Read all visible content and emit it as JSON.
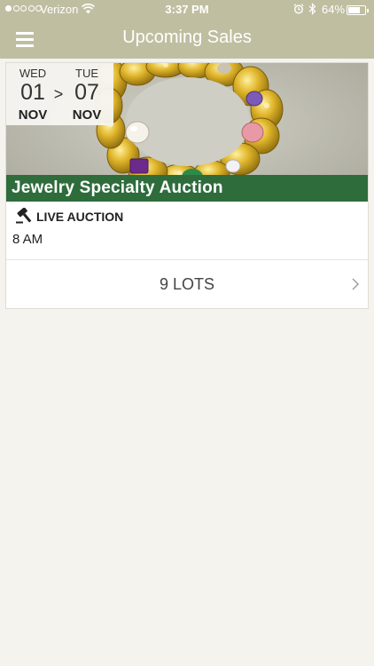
{
  "status_bar": {
    "carrier": "Verizon",
    "time": "3:37 PM",
    "battery": "64%",
    "signal_bars_filled": 1,
    "signal_bars_total": 5,
    "battery_level": 0.64
  },
  "nav": {
    "title": "Upcoming Sales",
    "menu_icon": "hamburger-menu-icon"
  },
  "sale": {
    "start": {
      "day": "WED",
      "date": "01",
      "month": "NOV"
    },
    "end": {
      "day": "TUE",
      "date": "07",
      "month": "NOV"
    },
    "separator": ">",
    "title": "Jewelry Specialty Auction",
    "type": "LIVE AUCTION",
    "type_icon": "gavel-icon",
    "time": "8 AM",
    "lots": "9 LOTS",
    "chevron_icon": "chevron-right-icon"
  },
  "colors": {
    "nav_bar": "#c0bea1",
    "title_band": "#2f6c3c",
    "background": "#f4f3ee"
  }
}
